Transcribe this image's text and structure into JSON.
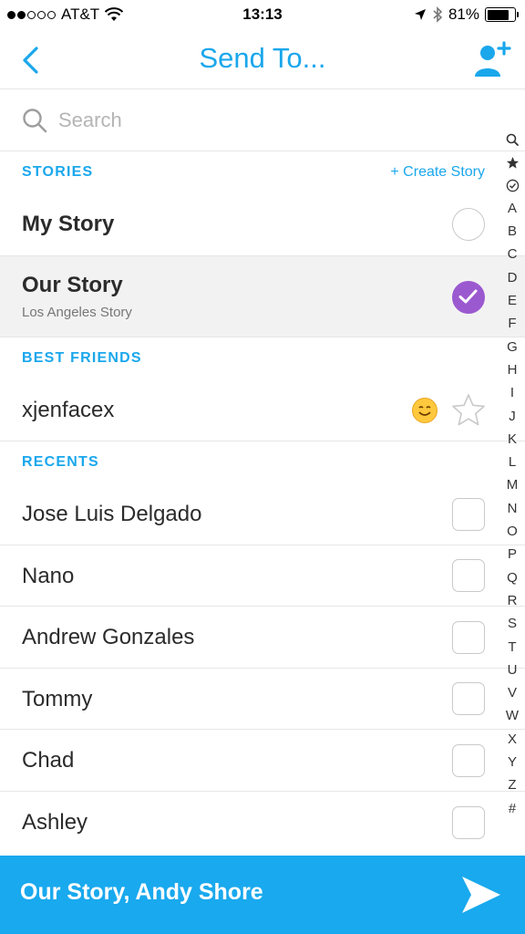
{
  "status_bar": {
    "carrier": "AT&T",
    "time": "13:13",
    "battery": "81%",
    "battery_level": 0.81
  },
  "header": {
    "title": "Send To..."
  },
  "search": {
    "placeholder": "Search"
  },
  "stories": {
    "label": "STORIES",
    "create_label": "+ Create Story",
    "items": [
      {
        "name": "My Story",
        "subtitle": ""
      },
      {
        "name": "Our Story",
        "subtitle": "Los Angeles Story"
      }
    ]
  },
  "best_friends": {
    "label": "BEST FRIENDS",
    "items": [
      {
        "name": "xjenfacex"
      }
    ]
  },
  "recents": {
    "label": "RECENTS",
    "items": [
      {
        "name": "Jose Luis Delgado"
      },
      {
        "name": "Nano"
      },
      {
        "name": "Andrew Gonzales"
      },
      {
        "name": "Tommy"
      },
      {
        "name": "Chad"
      },
      {
        "name": "Ashley"
      }
    ]
  },
  "alpha_index": {
    "letters": [
      "A",
      "B",
      "C",
      "D",
      "E",
      "F",
      "G",
      "H",
      "I",
      "J",
      "K",
      "L",
      "M",
      "N",
      "O",
      "P",
      "Q",
      "R",
      "S",
      "T",
      "U",
      "V",
      "W",
      "X",
      "Y",
      "Z",
      "#"
    ]
  },
  "bottom_bar": {
    "label": "Our Story, Andy Shore"
  },
  "colors": {
    "accent": "#1aa7ec",
    "selected_check": "#9b59d0",
    "send_bar": "#19a9ee"
  }
}
